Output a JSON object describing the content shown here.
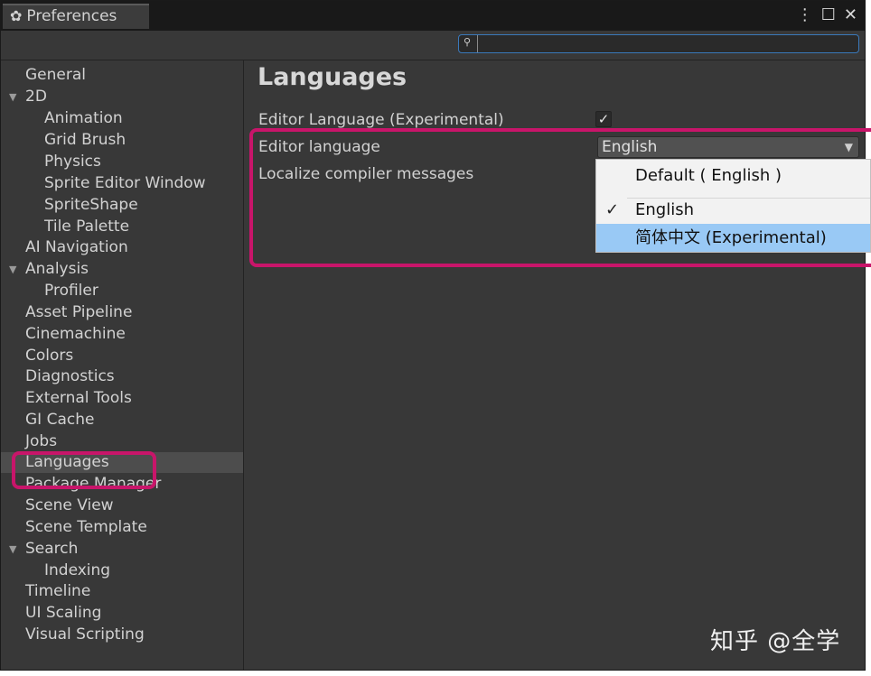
{
  "window": {
    "tab_title": "Preferences",
    "tab_icon": "gear-icon",
    "controls": {
      "menu_glyph": "⋮",
      "maximize_glyph": "☐",
      "close_glyph": "✕"
    }
  },
  "search": {
    "icon": "search-icon",
    "value": "",
    "placeholder": ""
  },
  "sidebar": {
    "items": [
      {
        "label": "General",
        "indent": 0,
        "expander": false
      },
      {
        "label": "2D",
        "indent": 0,
        "expander": true
      },
      {
        "label": "Animation",
        "indent": 1,
        "expander": false
      },
      {
        "label": "Grid Brush",
        "indent": 1,
        "expander": false
      },
      {
        "label": "Physics",
        "indent": 1,
        "expander": false
      },
      {
        "label": "Sprite Editor Window",
        "indent": 1,
        "expander": false
      },
      {
        "label": "SpriteShape",
        "indent": 1,
        "expander": false
      },
      {
        "label": "Tile Palette",
        "indent": 1,
        "expander": false
      },
      {
        "label": "AI Navigation",
        "indent": 0,
        "expander": false
      },
      {
        "label": "Analysis",
        "indent": 0,
        "expander": true
      },
      {
        "label": "Profiler",
        "indent": 1,
        "expander": false
      },
      {
        "label": "Asset Pipeline",
        "indent": 0,
        "expander": false
      },
      {
        "label": "Cinemachine",
        "indent": 0,
        "expander": false
      },
      {
        "label": "Colors",
        "indent": 0,
        "expander": false
      },
      {
        "label": "Diagnostics",
        "indent": 0,
        "expander": false
      },
      {
        "label": "External Tools",
        "indent": 0,
        "expander": false
      },
      {
        "label": "GI Cache",
        "indent": 0,
        "expander": false
      },
      {
        "label": "Jobs",
        "indent": 0,
        "expander": false
      },
      {
        "label": "Languages",
        "indent": 0,
        "expander": false,
        "selected": true
      },
      {
        "label": "Package Manager",
        "indent": 0,
        "expander": false
      },
      {
        "label": "Scene View",
        "indent": 0,
        "expander": false
      },
      {
        "label": "Scene Template",
        "indent": 0,
        "expander": false
      },
      {
        "label": "Search",
        "indent": 0,
        "expander": true
      },
      {
        "label": "Indexing",
        "indent": 1,
        "expander": false
      },
      {
        "label": "Timeline",
        "indent": 0,
        "expander": false
      },
      {
        "label": "UI Scaling",
        "indent": 0,
        "expander": false
      },
      {
        "label": "Visual Scripting",
        "indent": 0,
        "expander": false
      }
    ]
  },
  "content": {
    "title": "Languages",
    "settings": {
      "editor_language_experimental": {
        "label": "Editor Language (Experimental)",
        "checked": true
      },
      "editor_language": {
        "label": "Editor language",
        "selected": "English"
      },
      "localize_compiler": {
        "label": "Localize compiler messages"
      }
    }
  },
  "language_menu": {
    "items": [
      {
        "label": "Default ( English )",
        "checked": false
      },
      {
        "label": "English",
        "checked": true
      },
      {
        "label": "简体中文 (Experimental)",
        "checked": false,
        "hover": true
      }
    ]
  },
  "watermark": "知乎 @全学",
  "colors": {
    "highlight": "#c8156a",
    "menu_hover": "#99c9f5",
    "search_border": "#3a79bb"
  }
}
